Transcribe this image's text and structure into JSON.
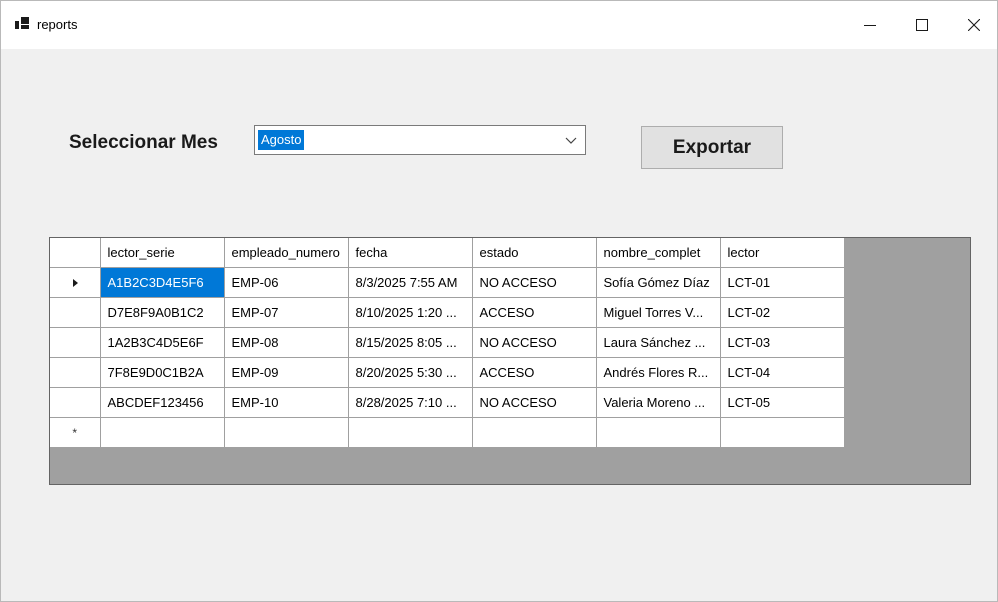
{
  "window": {
    "title": "reports",
    "controls": {
      "minimize": "—",
      "maximize": "☐",
      "close": "✕"
    }
  },
  "filter": {
    "label": "Seleccionar Mes",
    "selected_month": "Agosto"
  },
  "actions": {
    "export_label": "Exportar"
  },
  "grid": {
    "columns": [
      "lector_serie",
      "empleado_numero",
      "fecha",
      "estado",
      "nombre_complet",
      "lector"
    ],
    "rows": [
      [
        "A1B2C3D4E5F6",
        "EMP-06",
        "8/3/2025 7:55 AM",
        "NO ACCESO",
        "Sofía Gómez Díaz",
        "LCT-01"
      ],
      [
        "D7E8F9A0B1C2",
        "EMP-07",
        "8/10/2025 1:20 ...",
        "ACCESO",
        "Miguel Torres V...",
        "LCT-02"
      ],
      [
        "1A2B3C4D5E6F",
        "EMP-08",
        "8/15/2025 8:05 ...",
        "NO ACCESO",
        "Laura Sánchez ...",
        "LCT-03"
      ],
      [
        "7F8E9D0C1B2A",
        "EMP-09",
        "8/20/2025 5:30 ...",
        "ACCESO",
        "Andrés Flores R...",
        "LCT-04"
      ],
      [
        "ABCDEF123456",
        "EMP-10",
        "8/28/2025 7:10 ...",
        "NO ACCESO",
        "Valeria Moreno ...",
        "LCT-05"
      ]
    ],
    "current_row_marker": "▶",
    "new_row_marker": "*"
  }
}
